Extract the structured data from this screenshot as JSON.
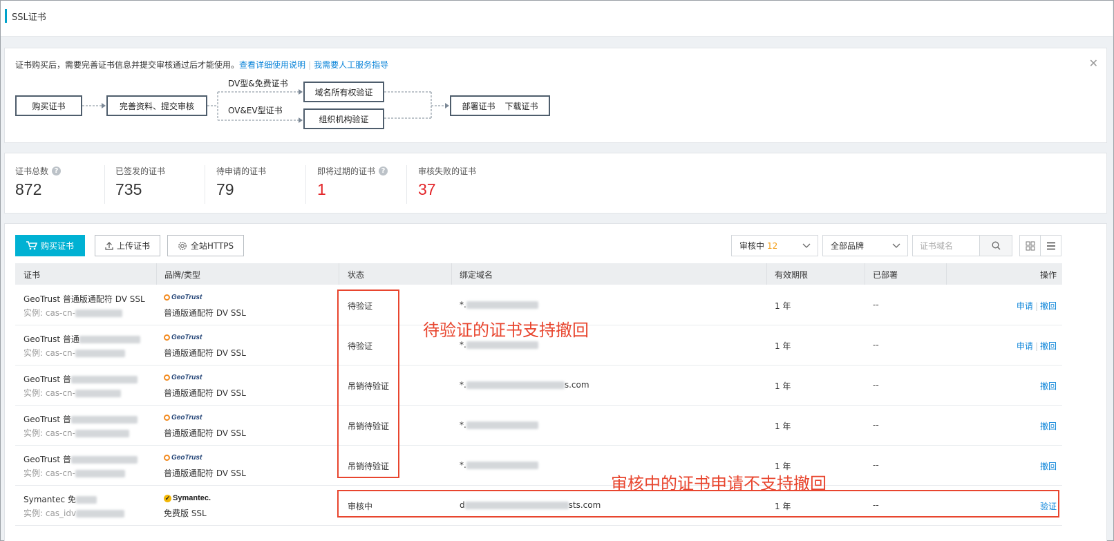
{
  "page": {
    "title": "SSL证书"
  },
  "notice": {
    "text": "证书购买后，需要完善证书信息并提交审核通过后才能使用。",
    "link1": "查看详细使用说明",
    "link2": "我需要人工服务指导"
  },
  "flow": {
    "step1": "购买证书",
    "step2": "完善资料、提交审核",
    "branch1": "DV型&免费证书",
    "branch2": "OV&EV型证书",
    "step3a": "域名所有权验证",
    "step3b": "组织机构验证",
    "step4a": "部署证书",
    "step4b": "下载证书"
  },
  "stats": [
    {
      "label": "证书总数",
      "value": "872",
      "help": true,
      "red": false
    },
    {
      "label": "已签发的证书",
      "value": "735",
      "help": false,
      "red": false
    },
    {
      "label": "待申请的证书",
      "value": "79",
      "help": false,
      "red": false
    },
    {
      "label": "即将过期的证书",
      "value": "1",
      "help": true,
      "red": true
    },
    {
      "label": "审核失败的证书",
      "value": "37",
      "help": false,
      "red": true
    }
  ],
  "toolbar": {
    "buy": "购买证书",
    "upload": "上传证书",
    "https": "全站HTTPS",
    "status_filter": "审核中",
    "status_count": "12",
    "brand_filter": "全部品牌",
    "search_placeholder": "证书域名"
  },
  "table": {
    "headers": [
      "证书",
      "品牌/类型",
      "状态",
      "绑定域名",
      "有效期限",
      "已部署",
      "操作"
    ],
    "rows": [
      {
        "name": "GeoTrust 普通版通配符 DV SSL",
        "instance": "实例: cas-cn-",
        "brand": "GeoTrust",
        "type": "普通版通配符 DV SSL",
        "status": "待验证",
        "domain_prefix": "*.",
        "domain_suffix": "",
        "period": "1 年",
        "deployed": "--",
        "actions": [
          "申请",
          "撤回"
        ]
      },
      {
        "name": "GeoTrust 普通",
        "instance": "实例: cas-cn-",
        "brand": "GeoTrust",
        "type": "普通版通配符 DV SSL",
        "status": "待验证",
        "domain_prefix": "*.",
        "domain_suffix": "",
        "period": "1 年",
        "deployed": "--",
        "actions": [
          "申请",
          "撤回"
        ]
      },
      {
        "name": "GeoTrust 普",
        "instance": "实例: cas-cn-",
        "brand": "GeoTrust",
        "type": "普通版通配符 DV SSL",
        "status": "吊销待验证",
        "domain_prefix": "*.",
        "domain_suffix": "s.com",
        "period": "1 年",
        "deployed": "--",
        "actions": [
          "撤回"
        ]
      },
      {
        "name": "GeoTrust 普",
        "instance": "实例: cas-cn-",
        "brand": "GeoTrust",
        "type": "普通版通配符 DV SSL",
        "status": "吊销待验证",
        "domain_prefix": "*.",
        "domain_suffix": "",
        "period": "1 年",
        "deployed": "--",
        "actions": [
          "撤回"
        ]
      },
      {
        "name": "GeoTrust 普",
        "instance": "实例: cas-cn-",
        "brand": "GeoTrust",
        "type": "普通版通配符 DV SSL",
        "status": "吊销待验证",
        "domain_prefix": "*.",
        "domain_suffix": "",
        "period": "1 年",
        "deployed": "--",
        "actions": [
          "撤回"
        ]
      },
      {
        "name": "Symantec 免",
        "instance": "实例: cas_idv",
        "brand": "Symantec.",
        "type": "免费版 SSL",
        "status": "审核中",
        "domain_prefix": "d",
        "domain_suffix": "sts.com",
        "period": "1 年",
        "deployed": "--",
        "actions": [
          "验证"
        ]
      }
    ]
  },
  "annotations": {
    "a1": "待验证的证书支持撤回",
    "a2": "审核中的证书申请不支持撤回"
  },
  "colors": {
    "accent": "#00b1d3",
    "link": "#0b84d9",
    "alert": "#e3262a",
    "annotation": "#e8452e"
  }
}
